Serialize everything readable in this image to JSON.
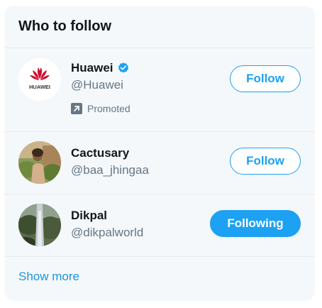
{
  "widget": {
    "title": "Who to follow",
    "show_more_label": "Show more"
  },
  "accounts": [
    {
      "name": "Huawei",
      "handle": "@Huawei",
      "verified": true,
      "promoted_label": "Promoted",
      "logo_text": "HUAWEI",
      "button_label": "Follow",
      "button_state": "follow"
    },
    {
      "name": "Cactusary",
      "handle": "@baa_jhingaa",
      "verified": false,
      "button_label": "Follow",
      "button_state": "follow"
    },
    {
      "name": "Dikpal",
      "handle": "@dikpalworld",
      "verified": false,
      "button_label": "Following",
      "button_state": "following"
    }
  ],
  "colors": {
    "accent": "#1da1f2",
    "link": "#1b95e0",
    "secondary_text": "#657786",
    "panel_background": "#f5f8fa",
    "huawei_red": "#cf0a2c"
  }
}
